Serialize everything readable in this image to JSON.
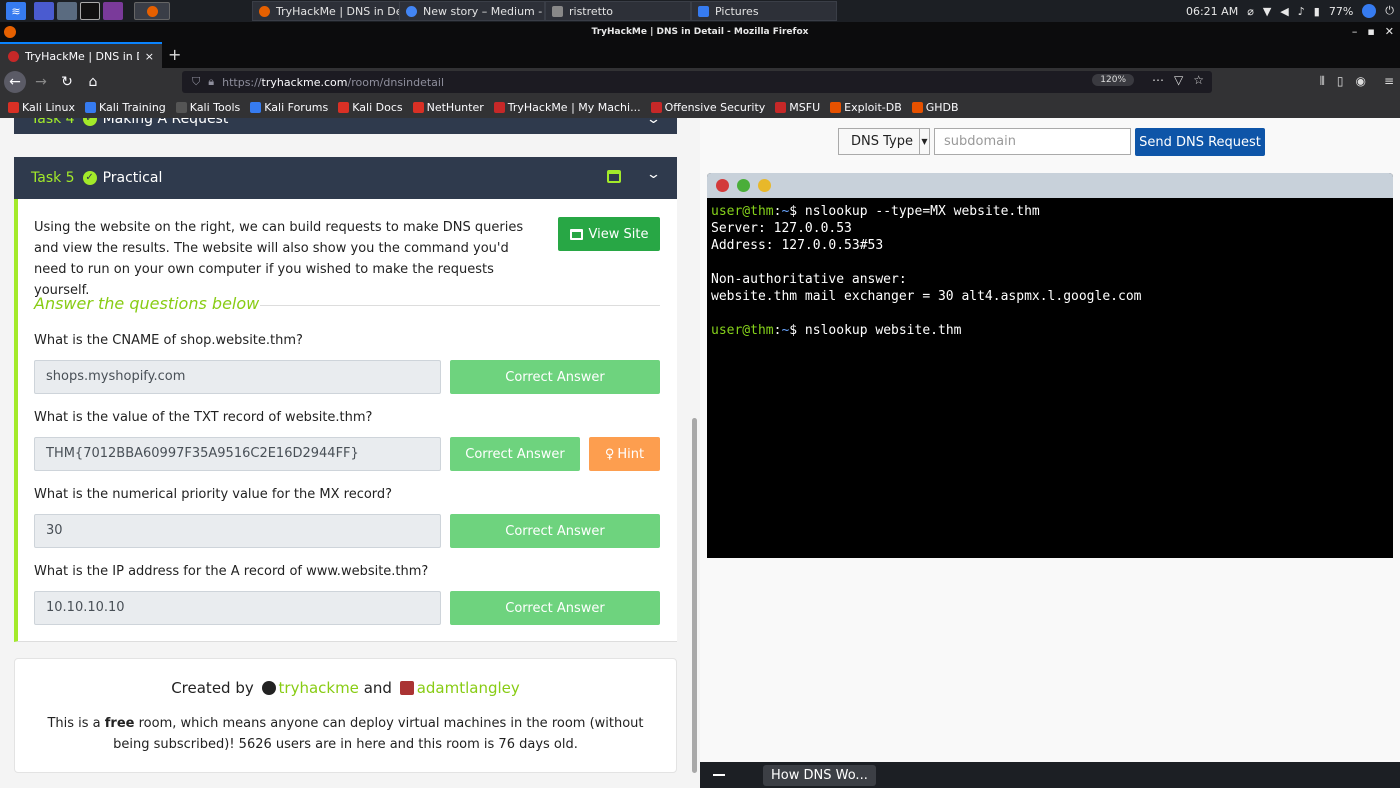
{
  "taskbar": {
    "windows": [
      {
        "label": "TryHackMe | DNS in Det..."
      },
      {
        "label": "New story – Medium - ..."
      },
      {
        "label": "ristretto"
      },
      {
        "label": "Pictures"
      }
    ],
    "clock": "06:21 AM",
    "battery": "77%"
  },
  "window": {
    "title": "TryHackMe | DNS in Detail - Mozilla Firefox"
  },
  "tab": {
    "title": "TryHackMe | DNS in Detail",
    "close": "×",
    "new": "+"
  },
  "url": {
    "prefix": "https://",
    "domain": "tryhackme.com",
    "path": "/room/dnsindetail",
    "zoom": "120%"
  },
  "bookmarks": [
    {
      "label": "Kali Linux",
      "color": "#d93025"
    },
    {
      "label": "Kali Training",
      "color": "#367bf0"
    },
    {
      "label": "Kali Tools",
      "color": "#555555"
    },
    {
      "label": "Kali Forums",
      "color": "#367bf0"
    },
    {
      "label": "Kali Docs",
      "color": "#d93025"
    },
    {
      "label": "NetHunter",
      "color": "#d93025"
    },
    {
      "label": "TryHackMe | My Machi...",
      "color": "#c62828"
    },
    {
      "label": "Offensive Security",
      "color": "#c62828"
    },
    {
      "label": "MSFU",
      "color": "#c62828"
    },
    {
      "label": "Exploit-DB",
      "color": "#e65100"
    },
    {
      "label": "GHDB",
      "color": "#e65100"
    }
  ],
  "task4": {
    "num": "Task 4",
    "title": "Making A Request"
  },
  "task5": {
    "num": "Task 5",
    "title": "Practical",
    "description": "Using the website on the right, we can build requests to make DNS queries and view the results. The website will also show you the command you'd need to run on your own computer if you wished to make the requests yourself.",
    "view_site": "View Site",
    "answer_heading": "Answer the questions below",
    "questions": [
      {
        "q": "What is the CNAME of shop.website.thm?",
        "a": "shops.myshopify.com",
        "btn": "Correct Answer"
      },
      {
        "q": "What is the value of the TXT record of website.thm?",
        "a": "THM{7012BBA60997F35A9516C2E16D2944FF}",
        "btn": "Correct Answer",
        "hint": "Hint"
      },
      {
        "q": "What is the numerical priority value for the MX record?",
        "a": "30",
        "btn": "Correct Answer"
      },
      {
        "q": "What is the IP address for the A record of www.website.thm?",
        "a": "10.10.10.10",
        "btn": "Correct Answer"
      }
    ]
  },
  "credits": {
    "created_by": "Created by",
    "author1": "tryhackme",
    "and": "and",
    "author2": "adamtlangley",
    "info_pre": "This is a",
    "info_free": "free",
    "info_post": "room, which means anyone can deploy virtual machines in the room (without being subscribed)! 5626 users are in here and this room is 76 days old."
  },
  "dns": {
    "type_label": "DNS Type",
    "subdomain_placeholder": "subdomain",
    "send": "Send DNS Request"
  },
  "terminal": {
    "prompt_user": "user@thm",
    "prompt_sep": ":",
    "prompt_dir": "~",
    "prompt_sign": "$",
    "cmd1": " nslookup --type=MX website.thm",
    "out1": "Server: 127.0.0.53",
    "out2": "Address: 127.0.0.53#53",
    "out3": "Non-authoritative answer:",
    "out4": "website.thm mail exchanger = 30 alt4.aspmx.l.google.com",
    "cmd2": " nslookup website.thm"
  },
  "bottom": {
    "tab_label": "How DNS Wo..."
  },
  "colors": {
    "accent": "#a3ea2a",
    "task_header": "#2f3a4d",
    "correct": "#6ed37e",
    "hint": "#fd9e4f",
    "send": "#0e55a8"
  }
}
